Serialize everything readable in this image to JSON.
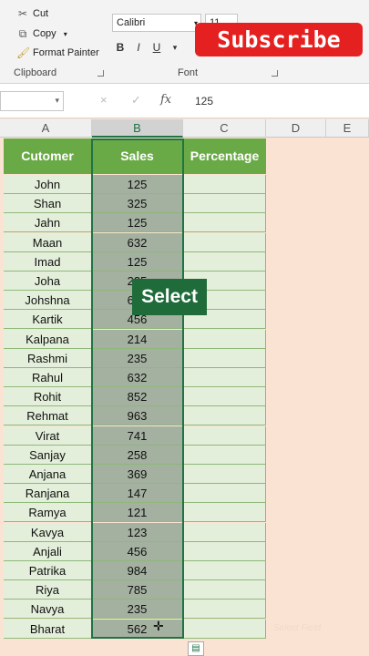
{
  "ribbon": {
    "clipboard": {
      "cut": "Cut",
      "copy": "Copy",
      "format_painter": "Format Painter",
      "group_label": "Clipboard"
    },
    "font": {
      "family": "Calibri",
      "size": "11",
      "bold": "B",
      "italic": "I",
      "underline": "U",
      "group_label": "Font"
    }
  },
  "overlay": {
    "subscribe": "Subscribe",
    "select": "Select",
    "watermark": "Select Field"
  },
  "formula_bar": {
    "value": "125",
    "cancel": "×",
    "enter": "✓",
    "fx": "fx"
  },
  "columns": [
    "A",
    "B",
    "C",
    "D",
    "E"
  ],
  "table": {
    "headers": [
      "Cutomer",
      "Sales",
      "Percentage"
    ],
    "rows": [
      [
        "John",
        "125"
      ],
      [
        "Shan",
        "325"
      ],
      [
        "Jahn",
        "125"
      ],
      [
        "Maan",
        "632"
      ],
      [
        "Imad",
        "125"
      ],
      [
        "Joha",
        "235"
      ],
      [
        "Johshna",
        "698"
      ],
      [
        "Kartik",
        "456"
      ],
      [
        "Kalpana",
        "214"
      ],
      [
        "Rashmi",
        "235"
      ],
      [
        "Rahul",
        "632"
      ],
      [
        "Rohit",
        "852"
      ],
      [
        "Rehmat",
        "963"
      ],
      [
        "Virat",
        "741"
      ],
      [
        "Sanjay",
        "258"
      ],
      [
        "Anjana",
        "369"
      ],
      [
        "Ranjana",
        "147"
      ],
      [
        "Ramya",
        "121"
      ],
      [
        "Kavya",
        "123"
      ],
      [
        "Anjali",
        "456"
      ],
      [
        "Patrika",
        "984"
      ],
      [
        "Riya",
        "785"
      ],
      [
        "Navya",
        "235"
      ],
      [
        "Bharat",
        "562"
      ]
    ]
  },
  "colors": {
    "header_green": "#6aaa46",
    "cell_green": "#e3efda",
    "selected_gray": "#a4b0a0",
    "empty_peach": "#fbe3d3"
  }
}
